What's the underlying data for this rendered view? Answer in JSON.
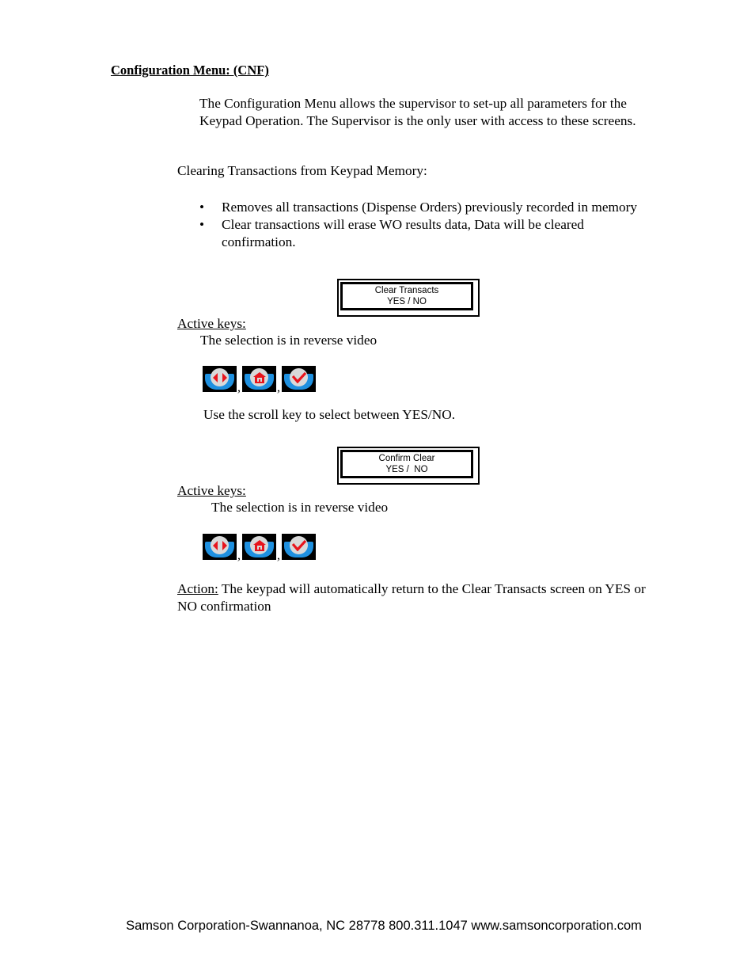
{
  "section": {
    "heading": "Configuration Menu: (CNF)",
    "intro": "The Configuration Menu allows the supervisor to set-up all parameters for the Keypad Operation.  The Supervisor is the only user with access to these screens."
  },
  "clearing": {
    "subheading": "Clearing Transactions from Keypad Memory:",
    "bullets": [
      "Removes all transactions (Dispense Orders) previously recorded in memory",
      "Clear transactions will erase WO results data, Data will be cleared confirmation."
    ],
    "bullet_glyph": "•"
  },
  "screen1": {
    "line1": "Clear Transacts",
    "line2": "YES / NO",
    "active_keys_label": "Active keys:",
    "note": "The selection is in reverse video",
    "keys": [
      {
        "icon": "scroll-left-right-icon"
      },
      {
        "icon": "home-icon"
      },
      {
        "icon": "check-icon"
      }
    ],
    "separator": ",",
    "instruction": "Use the scroll key to select between YES/NO."
  },
  "screen2": {
    "line1": "Confirm Clear",
    "line2": "YES /  NO",
    "active_keys_label": "Active keys:",
    "note": "The selection is in reverse video",
    "keys": [
      {
        "icon": "scroll-left-right-icon"
      },
      {
        "icon": "home-icon"
      },
      {
        "icon": "check-icon"
      }
    ],
    "separator": ","
  },
  "action": {
    "label": "Action:",
    "text": " The keypad will automatically return to the Clear Transacts screen on YES or NO confirmation"
  },
  "footer": {
    "text": "Samson Corporation-Swannanoa, NC 28778  800.311.1047 www.samsoncorporation.com"
  },
  "colors": {
    "key_background": "#000000",
    "key_band": "#1e90e0",
    "key_disc": "#d9d9d9",
    "key_glyph": "#e8141c"
  }
}
